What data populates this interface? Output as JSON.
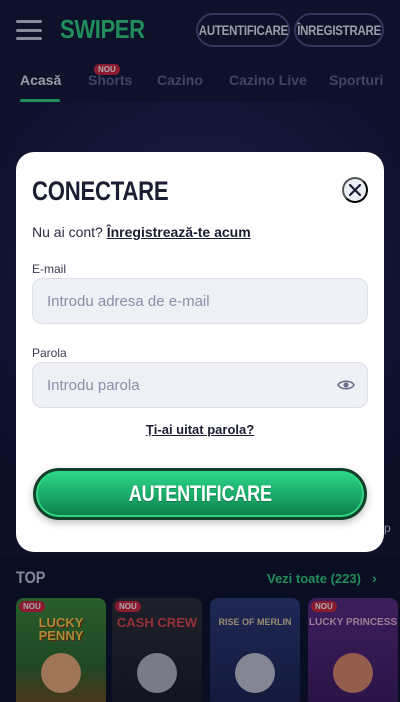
{
  "header": {
    "logo": "SWIPER",
    "login_button": "AUTENTIFICARE",
    "register_button": "ÎNREGISTRARE"
  },
  "nav": {
    "tabs": [
      {
        "label": "Acasă",
        "active": true
      },
      {
        "label": "Shorts",
        "badge": "NOU"
      },
      {
        "label": "Cazino"
      },
      {
        "label": "Cazino Live"
      },
      {
        "label": "Sporturi"
      }
    ]
  },
  "section": {
    "title": "TOP",
    "see_all": "Vezi toate (223)",
    "side_peek": "p",
    "games": [
      {
        "badge": "NOU",
        "title": "LUCKY PENNY"
      },
      {
        "badge": "NOU",
        "title": "CASH CREW"
      },
      {
        "badge": "",
        "title": "RISE OF MERLIN"
      },
      {
        "badge": "NOU",
        "title": "LUCKY PRINCESS"
      }
    ]
  },
  "modal": {
    "title": "CONECTARE",
    "no_account_text": "Nu ai cont?",
    "register_link": "Înregistrează-te acum",
    "email_label": "E-mail",
    "email_placeholder": "Introdu adresa de e-mail",
    "email_value": "",
    "password_label": "Parola",
    "password_placeholder": "Introdu parola",
    "password_value": "",
    "forgot_link": "Ți-ai uitat parola?",
    "submit_label": "AUTENTIFICARE"
  },
  "colors": {
    "accent": "#2fd57e",
    "background": "#0d1129",
    "header_bg": "#121735",
    "badge_red": "#d4263c",
    "modal_bg": "#ffffff",
    "button_green": "#1aa868"
  },
  "icons": {
    "menu": "hamburger-menu-icon",
    "close": "close-icon",
    "password_toggle": "eye-icon",
    "see_all_arrow": "chevron-right-icon"
  }
}
